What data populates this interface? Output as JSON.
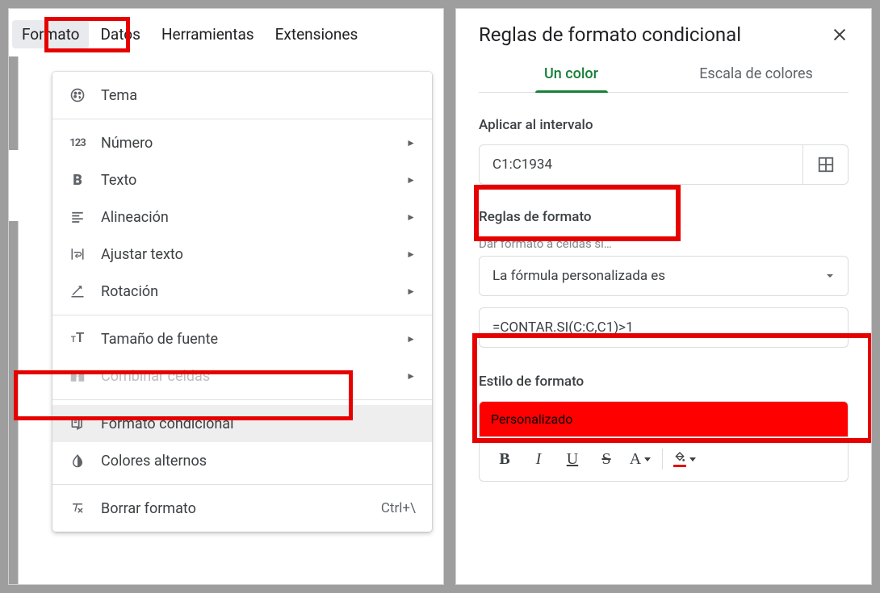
{
  "menubar": {
    "items": [
      "Formato",
      "Datos",
      "Herramientas",
      "Extensiones"
    ],
    "active_index": 0
  },
  "dropdown": {
    "items": [
      {
        "label": "Tema",
        "icon": "palette",
        "submenu": false
      },
      {
        "sep": true
      },
      {
        "label": "Número",
        "icon": "number",
        "submenu": true
      },
      {
        "label": "Texto",
        "icon": "bold",
        "submenu": true
      },
      {
        "label": "Alineación",
        "icon": "align",
        "submenu": true
      },
      {
        "label": "Ajustar texto",
        "icon": "wrap",
        "submenu": true
      },
      {
        "label": "Rotación",
        "icon": "rotate",
        "submenu": true
      },
      {
        "sep": true
      },
      {
        "label": "Tamaño de fuente",
        "icon": "fontsize",
        "submenu": true
      },
      {
        "label": "Combinar celdas",
        "icon": "merge",
        "submenu": true,
        "disabled": true
      },
      {
        "sep": true
      },
      {
        "label": "Formato condicional",
        "icon": "condformat",
        "submenu": false,
        "hovered": true
      },
      {
        "label": "Colores alternos",
        "icon": "altcolors",
        "submenu": false
      },
      {
        "sep": true
      },
      {
        "label": "Borrar formato",
        "icon": "clear",
        "submenu": false,
        "shortcut": "Ctrl+\\"
      }
    ]
  },
  "cf": {
    "title": "Reglas de formato condicional",
    "tabs": [
      "Un color",
      "Escala de colores"
    ],
    "range": {
      "label": "Aplicar al intervalo",
      "value": "C1:C1934"
    },
    "rules": {
      "label": "Reglas de formato",
      "helper": "Dar formato a celdas si…",
      "condition": "La fórmula personalizada es",
      "formula": "=CONTAR.SI(C:C,C1)>1"
    },
    "style": {
      "label": "Estilo de formato",
      "name": "Personalizado",
      "buttons": [
        "B",
        "I",
        "U",
        "S",
        "A",
        "fill"
      ]
    }
  }
}
